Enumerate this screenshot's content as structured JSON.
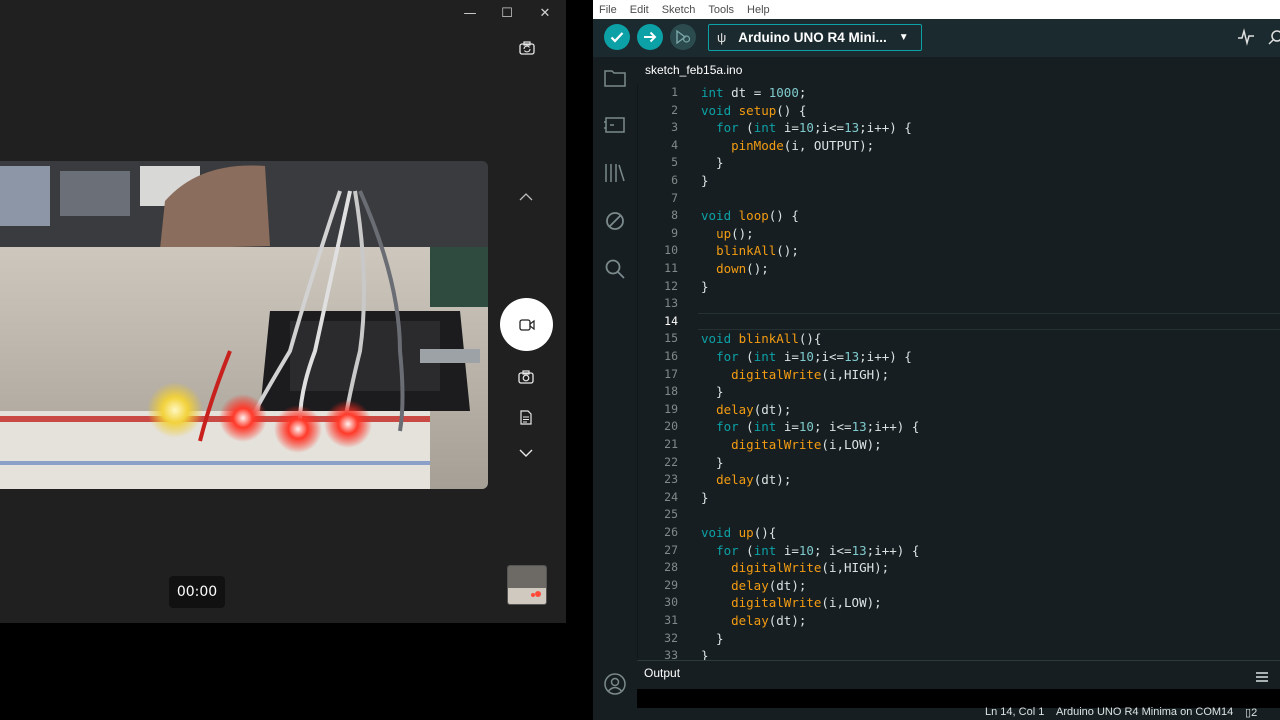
{
  "camera": {
    "timer": "00:00",
    "icons": [
      "minimize-icon",
      "maximize-icon",
      "close-icon",
      "switch-camera-icon",
      "chevron-up-icon",
      "video-icon",
      "camera-icon",
      "document-icon",
      "chevron-down-icon"
    ]
  },
  "ide": {
    "menu": [
      "File",
      "Edit",
      "Sketch",
      "Tools",
      "Help"
    ],
    "board": "Arduino UNO R4 Mini...",
    "tab": "sketch_feb15a.ino",
    "active_line": 14,
    "output_label": "Output",
    "status": {
      "position": "Ln 14, Col 1",
      "board": "Arduino UNO R4 Minima on COM14",
      "notifications": "2"
    },
    "colors": {
      "accent": "#0ca1a6",
      "function": "#f39c12",
      "background": "#171e21"
    },
    "code_lines": [
      "int dt = 1000;",
      "void setup() {",
      "  for (int i=10;i<=13;i++) {",
      "    pinMode(i, OUTPUT);",
      "  }",
      "}",
      "",
      "void loop() {",
      "  up();",
      "  blinkAll();",
      "  down();",
      "}",
      "",
      "",
      "void blinkAll(){",
      "  for (int i=10;i<=13;i++) {",
      "    digitalWrite(i,HIGH);",
      "  }",
      "  delay(dt);",
      "  for (int i=10; i<=13;i++) {",
      "    digitalWrite(i,LOW);",
      "  }",
      "  delay(dt);",
      "}",
      "",
      "void up(){",
      "  for (int i=10; i<=13;i++) {",
      "    digitalWrite(i,HIGH);",
      "    delay(dt);",
      "    digitalWrite(i,LOW);",
      "    delay(dt);",
      "  }",
      "}"
    ]
  }
}
